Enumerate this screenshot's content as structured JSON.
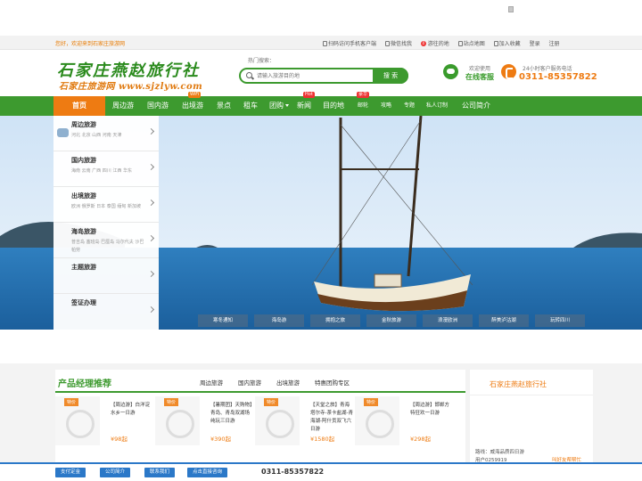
{
  "topbar": {
    "welcome": "您好，欢迎来到石家庄旅游网",
    "links": [
      "扫码访问手机客户端",
      "微信找我",
      "游往的地",
      "站点地图",
      "加入收藏",
      "登录",
      "注册"
    ],
    "cart_count": "0"
  },
  "header": {
    "logo_main": "石家庄燕赵旅行社",
    "logo_sub": "石家庄旅游网 www.sjzlyw.com",
    "hot_search_label": "热门搜索：",
    "search_placeholder": "请输入旅游目的地",
    "search_button": "搜 索",
    "service_title": "欢迎使用",
    "service_label": "在线客服",
    "tel_title": "24小时客户服务电话",
    "tel_number": "0311-85357822"
  },
  "nav": {
    "home": "首页",
    "items": [
      "周边游",
      "国内游",
      "出境游",
      "景点",
      "租车",
      "团购",
      "新闻",
      "目的地",
      "邮轮",
      "攻略",
      "专题",
      "私人订制",
      "公司简介"
    ],
    "badges": {
      "wifi": "WiFi",
      "hot": "Hot",
      "new": "豪华"
    }
  },
  "side_categories": [
    {
      "title": "周边旅游",
      "sub": "河北 北京 山西 河南 天津"
    },
    {
      "title": "国内旅游",
      "sub": "海南 云南 广西 四川 江西 华东"
    },
    {
      "title": "出境旅游",
      "sub": "欧洲 俄罗斯 日本 泰国 缅甸 新加坡"
    },
    {
      "title": "海岛旅游",
      "sub": "普吉岛 塞班岛 巴厘岛 马尔代夫 沙巴 帕劳"
    },
    {
      "title": "主题旅游",
      "sub": ""
    },
    {
      "title": "签证办理",
      "sub": ""
    }
  ],
  "banner_tabs": [
    "寒冬通知",
    "海岛游",
    "拥抱之旅",
    "金秋旅游",
    "浪漫欧洲",
    "醉美泸沽湖",
    "玩转四川"
  ],
  "products": {
    "heading": "产品经理推荐",
    "tabs": [
      "周边旅游",
      "国内旅游",
      "出境旅游",
      "特惠团购专区"
    ],
    "items": [
      {
        "tag": "特价",
        "name": "【周边游】白洋淀水乡一日游",
        "price": "¥98起"
      },
      {
        "tag": "特价",
        "name": "【暑期团】天购物】青岛、青岛双湖场纯玩三日游",
        "price": "¥390起"
      },
      {
        "tag": "特价",
        "name": "【天堂之旅】青海塔尔寺-茶卡盐湖-青海湖-阿什贡双飞六日游",
        "price": "¥1580起"
      },
      {
        "tag": "特价",
        "name": "【周边游】邯郸方特狂欢一日游",
        "price": "¥298起"
      }
    ]
  },
  "agency": {
    "name": "石家庄燕赵旅行社",
    "line1": "路线：威海品质四日游",
    "line2": "用户0259919",
    "action": "叫好友帮帮忙"
  },
  "footer": {
    "buttons": [
      "支付定金",
      "公司简介",
      "联系我们",
      "点击直接咨询"
    ],
    "phone": "0311-85357822"
  }
}
